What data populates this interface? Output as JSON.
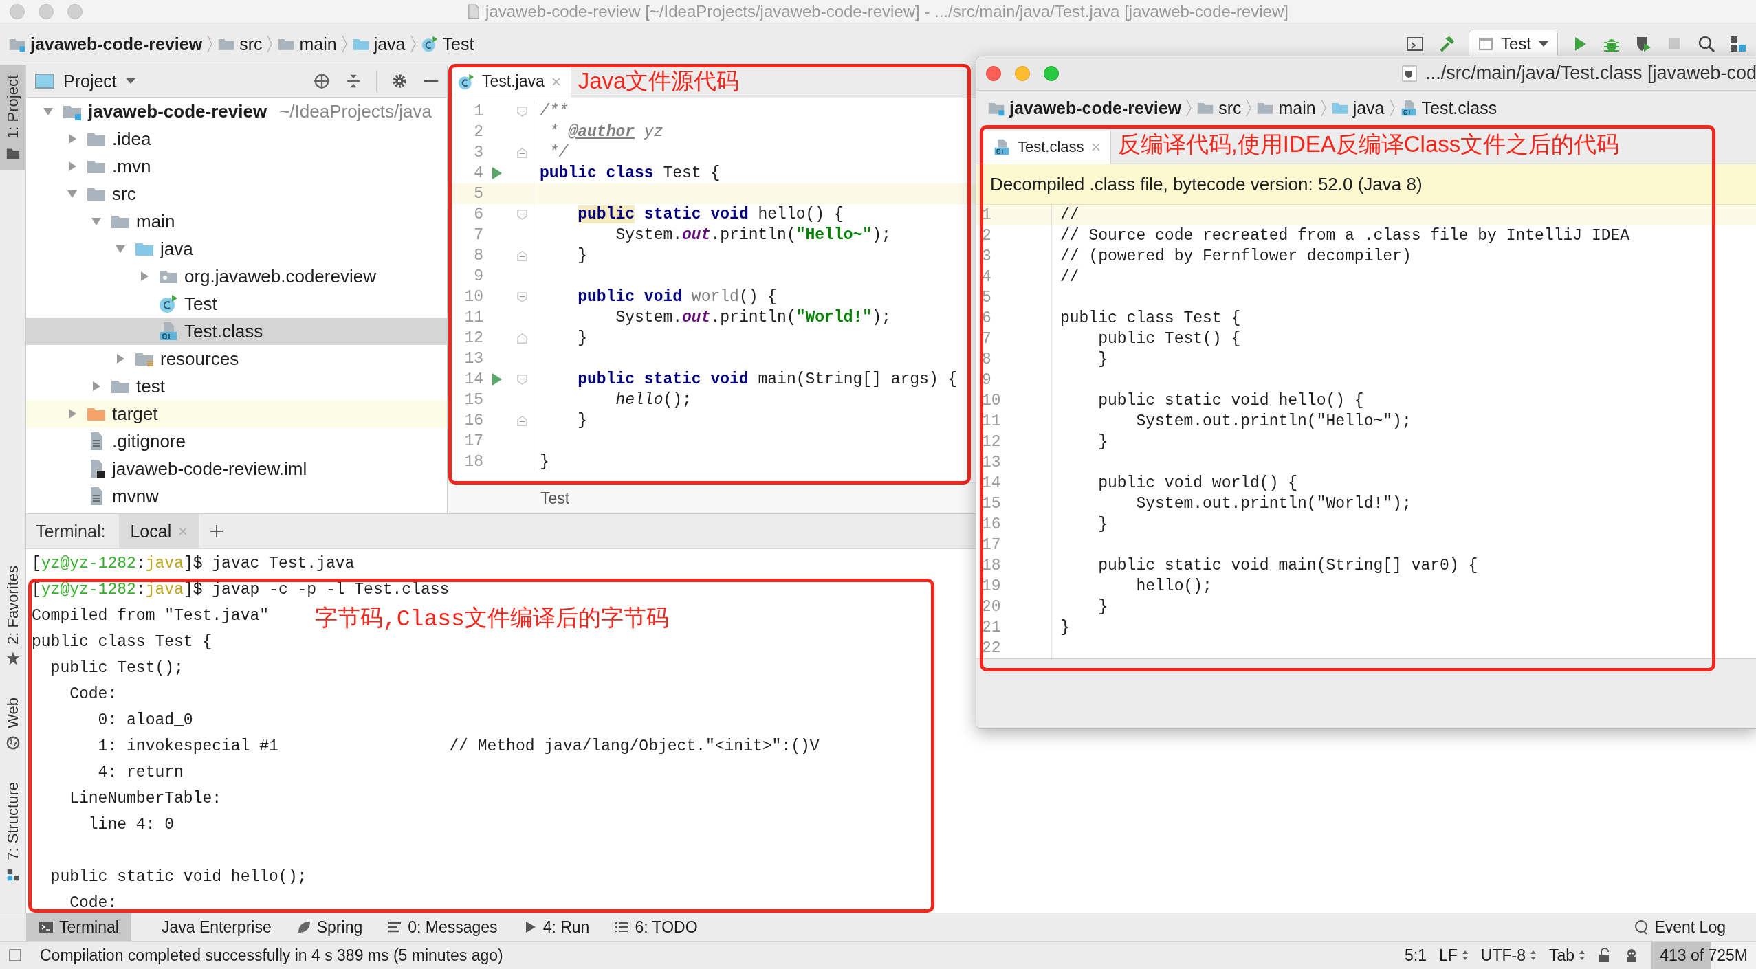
{
  "window": {
    "title": "javaweb-code-review [~/IdeaProjects/javaweb-code-review] - .../src/main/java/Test.java [javaweb-code-review]"
  },
  "navbar": {
    "breadcrumbs": [
      {
        "label": "javaweb-code-review",
        "kind": "project"
      },
      {
        "label": "src",
        "kind": "folder"
      },
      {
        "label": "main",
        "kind": "folder"
      },
      {
        "label": "java",
        "kind": "source-folder"
      },
      {
        "label": "Test",
        "kind": "class"
      }
    ],
    "run_config": "Test"
  },
  "side_strip": {
    "top": [
      {
        "label": "1: Project",
        "kind": "folder",
        "selected": true
      }
    ],
    "bottom": [
      {
        "label": "2: Favorites",
        "kind": "star",
        "selected": false
      },
      {
        "label": "Web",
        "kind": "globe",
        "selected": false
      },
      {
        "label": "7: Structure",
        "kind": "structure",
        "selected": false
      }
    ]
  },
  "project_panel": {
    "title": "Project",
    "tree": [
      {
        "label": "javaweb-code-review",
        "hint": "~/IdeaProjects/java",
        "kind": "project",
        "expanded": true,
        "selected": false,
        "children": [
          {
            "label": ".idea",
            "kind": "folder",
            "expanded": false,
            "selected": false
          },
          {
            "label": ".mvn",
            "kind": "folder",
            "expanded": false,
            "selected": false
          },
          {
            "label": "src",
            "kind": "folder",
            "expanded": true,
            "selected": false,
            "children": [
              {
                "label": "main",
                "kind": "folder",
                "expanded": true,
                "selected": false,
                "children": [
                  {
                    "label": "java",
                    "kind": "source-folder",
                    "expanded": true,
                    "selected": false,
                    "children": [
                      {
                        "label": "org.javaweb.codereview",
                        "kind": "package",
                        "expanded": false,
                        "selected": false
                      },
                      {
                        "label": "Test",
                        "kind": "class",
                        "selected": false
                      },
                      {
                        "label": "Test.class",
                        "kind": "class-file",
                        "selected": true
                      }
                    ]
                  },
                  {
                    "label": "resources",
                    "kind": "resources-folder",
                    "expanded": false,
                    "selected": false
                  }
                ]
              },
              {
                "label": "test",
                "kind": "folder",
                "expanded": false,
                "selected": false
              }
            ]
          },
          {
            "label": "target",
            "kind": "excluded-folder",
            "expanded": false,
            "selected": false
          },
          {
            "label": ".gitignore",
            "kind": "text-file",
            "selected": false
          },
          {
            "label": "javaweb-code-review.iml",
            "kind": "module-file",
            "selected": false
          },
          {
            "label": "mvnw",
            "kind": "text-file",
            "selected": false
          }
        ]
      }
    ]
  },
  "editor": {
    "tabs": [
      {
        "label": "Test.java",
        "kind": "class",
        "selected": true
      }
    ],
    "annotation": "Java文件源代码",
    "breadcrumb": "Test",
    "lines": [
      {
        "n": "1",
        "fold_start": true,
        "segments": [
          {
            "text": "/**",
            "kind": "comment"
          }
        ]
      },
      {
        "n": "2",
        "segments": [
          {
            "text": " * ",
            "kind": "comment"
          },
          {
            "text": "@author",
            "kind": "doc-tag"
          },
          {
            "text": " yz",
            "kind": "comment"
          }
        ]
      },
      {
        "n": "3",
        "fold_end": true,
        "segments": [
          {
            "text": " */",
            "kind": "comment"
          }
        ]
      },
      {
        "n": "4",
        "run": true,
        "segments": [
          {
            "text": "public class",
            "kind": "keyword"
          },
          {
            "text": " Test {",
            "kind": "plain"
          }
        ]
      },
      {
        "n": "5",
        "current": true
      },
      {
        "n": "6",
        "fold_start": true,
        "segments": [
          {
            "text": "    public",
            "kind": "keyword-marked"
          },
          {
            "text": " static void",
            "kind": "keyword"
          },
          {
            "text": " hello() {",
            "kind": "plain"
          }
        ]
      },
      {
        "n": "7",
        "segments": [
          {
            "text": "        System.",
            "kind": "plain"
          },
          {
            "text": "out",
            "kind": "field"
          },
          {
            "text": ".println(",
            "kind": "plain"
          },
          {
            "text": "\"Hello~\"",
            "kind": "string"
          },
          {
            "text": ");",
            "kind": "plain"
          }
        ]
      },
      {
        "n": "8",
        "fold_end": true,
        "segments": [
          {
            "text": "    }",
            "kind": "plain"
          }
        ]
      },
      {
        "n": "9"
      },
      {
        "n": "10",
        "fold_start": true,
        "segments": [
          {
            "text": "    public void",
            "kind": "keyword"
          },
          {
            "text": " world",
            "kind": "unused"
          },
          {
            "text": "() {",
            "kind": "plain"
          }
        ]
      },
      {
        "n": "11",
        "segments": [
          {
            "text": "        System.",
            "kind": "plain"
          },
          {
            "text": "out",
            "kind": "field"
          },
          {
            "text": ".println(",
            "kind": "plain"
          },
          {
            "text": "\"World!\"",
            "kind": "string"
          },
          {
            "text": ");",
            "kind": "plain"
          }
        ]
      },
      {
        "n": "12",
        "fold_end": true,
        "segments": [
          {
            "text": "    }",
            "kind": "plain"
          }
        ]
      },
      {
        "n": "13"
      },
      {
        "n": "14",
        "run": true,
        "fold_start": true,
        "segments": [
          {
            "text": "    public static void",
            "kind": "keyword"
          },
          {
            "text": " main(String[] args) {",
            "kind": "plain"
          }
        ]
      },
      {
        "n": "15",
        "segments": [
          {
            "text": "        hello",
            "kind": "static-call"
          },
          {
            "text": "();",
            "kind": "plain"
          }
        ]
      },
      {
        "n": "16",
        "fold_end": true,
        "segments": [
          {
            "text": "    }",
            "kind": "plain"
          }
        ]
      },
      {
        "n": "17"
      },
      {
        "n": "18",
        "segments": [
          {
            "text": "}",
            "kind": "plain"
          }
        ]
      }
    ]
  },
  "decompiler_window": {
    "title": ".../src/main/java/Test.class [javaweb-cod",
    "breadcrumbs": [
      {
        "label": "javaweb-code-review",
        "kind": "project"
      },
      {
        "label": "src",
        "kind": "folder"
      },
      {
        "label": "main",
        "kind": "folder"
      },
      {
        "label": "java",
        "kind": "source-folder"
      },
      {
        "label": "Test.class",
        "kind": "class-file"
      }
    ],
    "tabs": [
      {
        "label": "Test.class",
        "kind": "class-file",
        "selected": true
      }
    ],
    "annotation": "反编译代码,使用IDEA反编译Class文件之后的代码",
    "banner": "Decompiled .class file, bytecode version: 52.0 (Java 8)",
    "lines": [
      {
        "n": "1",
        "text": "//",
        "current": true
      },
      {
        "n": "2",
        "text": "// Source code recreated from a .class file by IntelliJ IDEA"
      },
      {
        "n": "3",
        "text": "// (powered by Fernflower decompiler)"
      },
      {
        "n": "4",
        "text": "//"
      },
      {
        "n": "5"
      },
      {
        "n": "6",
        "text": "public class Test {"
      },
      {
        "n": "7",
        "text": "    public Test() {"
      },
      {
        "n": "8",
        "text": "    }"
      },
      {
        "n": "9"
      },
      {
        "n": "10",
        "text": "    public static void hello() {"
      },
      {
        "n": "11",
        "text": "        System.out.println(\"Hello~\");"
      },
      {
        "n": "12",
        "text": "    }"
      },
      {
        "n": "13"
      },
      {
        "n": "14",
        "text": "    public void world() {"
      },
      {
        "n": "15",
        "text": "        System.out.println(\"World!\");"
      },
      {
        "n": "16",
        "text": "    }"
      },
      {
        "n": "17"
      },
      {
        "n": "18",
        "text": "    public static void main(String[] var0) {"
      },
      {
        "n": "19",
        "text": "        hello();"
      },
      {
        "n": "20",
        "text": "    }"
      },
      {
        "n": "21",
        "text": "}"
      },
      {
        "n": "22"
      }
    ]
  },
  "terminal": {
    "label": "Terminal:",
    "tabs": [
      {
        "label": "Local",
        "selected": true
      }
    ],
    "annotation": "字节码,Class文件编译后的字节码",
    "lines": [
      {
        "segments": [
          {
            "text": "[",
            "kind": "plain"
          },
          {
            "text": "yz@yz-1282",
            "kind": "user"
          },
          {
            "text": ":",
            "kind": "plain"
          },
          {
            "text": "java",
            "kind": "dir"
          },
          {
            "text": "]$ javac Test.java",
            "kind": "plain"
          }
        ]
      },
      {
        "segments": [
          {
            "text": "[",
            "kind": "plain"
          },
          {
            "text": "yz@yz-1282",
            "kind": "user"
          },
          {
            "text": ":",
            "kind": "plain"
          },
          {
            "text": "java",
            "kind": "dir"
          },
          {
            "text": "]$ javap -c -p -l Test.class",
            "kind": "plain"
          }
        ]
      },
      {
        "segments": [
          {
            "text": "Compiled from \"Test.java\"",
            "kind": "plain"
          }
        ]
      },
      {
        "segments": [
          {
            "text": "public class Test {",
            "kind": "plain"
          }
        ]
      },
      {
        "segments": [
          {
            "text": "  public Test();",
            "kind": "plain"
          }
        ]
      },
      {
        "segments": [
          {
            "text": "    Code:",
            "kind": "plain"
          }
        ]
      },
      {
        "segments": [
          {
            "text": "       0: aload_0",
            "kind": "plain"
          }
        ]
      },
      {
        "segments": [
          {
            "text": "       1: invokespecial #1                  // Method java/lang/Object.\"<init>\":()V",
            "kind": "plain"
          }
        ]
      },
      {
        "segments": [
          {
            "text": "       4: return",
            "kind": "plain"
          }
        ]
      },
      {
        "segments": [
          {
            "text": "    LineNumberTable:",
            "kind": "plain"
          }
        ]
      },
      {
        "segments": [
          {
            "text": "      line 4: 0",
            "kind": "plain"
          }
        ]
      },
      {
        "blank": true
      },
      {
        "segments": [
          {
            "text": "  public static void hello();",
            "kind": "plain"
          }
        ]
      },
      {
        "segments": [
          {
            "text": "    Code:",
            "kind": "plain"
          }
        ]
      }
    ]
  },
  "tool_window_bar": {
    "items": [
      {
        "label": "Terminal",
        "kind": "terminal",
        "selected": true
      },
      {
        "label": "Java Enterprise",
        "kind": "none",
        "selected": false
      },
      {
        "label": "Spring",
        "kind": "leaf",
        "selected": false
      },
      {
        "label": "0: Messages",
        "kind": "messages",
        "selected": false
      },
      {
        "label": "4: Run",
        "kind": "run",
        "selected": false
      },
      {
        "label": "6: TODO",
        "kind": "todo",
        "selected": false
      }
    ],
    "event_log": "Event Log"
  },
  "status_bar": {
    "message": "Compilation completed successfully in 4 s 389 ms (5 minutes ago)",
    "position": "5:1",
    "line_separator": "LF",
    "encoding": "UTF-8",
    "indent": "Tab",
    "memory": {
      "text": "413 of 725M",
      "level": 0.57
    }
  }
}
